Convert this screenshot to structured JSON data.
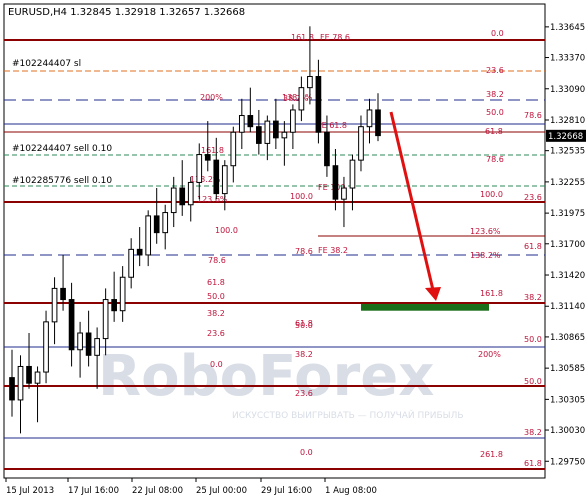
{
  "header": {
    "symbol_line": "EURUSD,H4  1.32845 1.32918 1.32657 1.32668"
  },
  "colors": {
    "up_candle": "#ffffff",
    "candle_edge": "#000000",
    "axis_text": "#000000",
    "fibo_level_text": "#c0143c",
    "line_blue": "#1f2d8c",
    "line_red": "#8b0000",
    "line_green_dash": "#2e8b57",
    "line_orange_dash": "#e07020",
    "arrow_red": "#e01010",
    "target_box": "#1a6e1a",
    "current_price_label_bg": "#000000",
    "watermark": "#d8dde6"
  },
  "watermark": {
    "brand": "RoboForex",
    "tagline": "ИСКУССТВО ВЫИГРЫВАТЬ — ПОЛУЧАЙ ПРИБЫЛЬ"
  },
  "chart_data": {
    "type": "candlestick",
    "title": "EURUSD,H4",
    "ohlc_header": {
      "open": 1.32845,
      "high": 1.32918,
      "low": 1.32657,
      "close": 1.32668
    },
    "current_price": 1.32668,
    "ylim": [
      1.296,
      1.3385
    ],
    "y_ticks": [
      "1.33645",
      "1.33370",
      "1.33090",
      "1.32810",
      "1.32535",
      "1.32255",
      "1.31975",
      "1.31700",
      "1.31420",
      "1.31140",
      "1.30865",
      "1.30585",
      "1.30305",
      "1.30030",
      "1.29750"
    ],
    "y_tick_values": [
      1.33645,
      1.3337,
      1.3309,
      1.3281,
      1.32535,
      1.32255,
      1.31975,
      1.317,
      1.3142,
      1.3114,
      1.30865,
      1.30585,
      1.30305,
      1.3003,
      1.2975
    ],
    "x_ticks": [
      "15 Jul 2013",
      "17 Jul 16:00",
      "22 Jul 08:00",
      "25 Jul 00:00",
      "29 Jul 16:00",
      "1 Aug 08:00"
    ],
    "candles": [
      [
        1.305,
        1.3075,
        1.3015,
        1.303
      ],
      [
        1.303,
        1.307,
        1.3,
        1.306
      ],
      [
        1.306,
        1.309,
        1.304,
        1.3045
      ],
      [
        1.3045,
        1.306,
        1.301,
        1.3055
      ],
      [
        1.3055,
        1.311,
        1.3045,
        1.31
      ],
      [
        1.31,
        1.314,
        1.308,
        1.313
      ],
      [
        1.313,
        1.316,
        1.311,
        1.312
      ],
      [
        1.312,
        1.3135,
        1.306,
        1.3075
      ],
      [
        1.3075,
        1.31,
        1.305,
        1.309
      ],
      [
        1.309,
        1.311,
        1.306,
        1.307
      ],
      [
        1.307,
        1.3095,
        1.304,
        1.3085
      ],
      [
        1.3085,
        1.313,
        1.307,
        1.312
      ],
      [
        1.312,
        1.3145,
        1.31,
        1.311
      ],
      [
        1.311,
        1.315,
        1.31,
        1.314
      ],
      [
        1.314,
        1.3175,
        1.313,
        1.3165
      ],
      [
        1.3165,
        1.3185,
        1.315,
        1.316
      ],
      [
        1.316,
        1.32,
        1.315,
        1.3195
      ],
      [
        1.3195,
        1.322,
        1.317,
        1.318
      ],
      [
        1.318,
        1.3205,
        1.3165,
        1.3198
      ],
      [
        1.3198,
        1.323,
        1.3185,
        1.322
      ],
      [
        1.322,
        1.3245,
        1.3195,
        1.3205
      ],
      [
        1.3205,
        1.323,
        1.319,
        1.3225
      ],
      [
        1.3225,
        1.326,
        1.321,
        1.325
      ],
      [
        1.325,
        1.328,
        1.3235,
        1.3245
      ],
      [
        1.3245,
        1.3265,
        1.321,
        1.3215
      ],
      [
        1.3215,
        1.3245,
        1.32,
        1.324
      ],
      [
        1.324,
        1.3275,
        1.3225,
        1.327
      ],
      [
        1.327,
        1.33,
        1.3255,
        1.3285
      ],
      [
        1.3285,
        1.331,
        1.327,
        1.3275
      ],
      [
        1.3275,
        1.329,
        1.325,
        1.326
      ],
      [
        1.326,
        1.3285,
        1.3245,
        1.328
      ],
      [
        1.328,
        1.33,
        1.3255,
        1.3265
      ],
      [
        1.3265,
        1.328,
        1.324,
        1.327
      ],
      [
        1.327,
        1.3295,
        1.3255,
        1.329
      ],
      [
        1.329,
        1.332,
        1.328,
        1.331
      ],
      [
        1.331,
        1.3365,
        1.3295,
        1.332
      ],
      [
        1.332,
        1.3335,
        1.326,
        1.327
      ],
      [
        1.327,
        1.3285,
        1.323,
        1.324
      ],
      [
        1.324,
        1.3255,
        1.32,
        1.321
      ],
      [
        1.321,
        1.323,
        1.3185,
        1.322
      ],
      [
        1.322,
        1.325,
        1.32,
        1.3245
      ],
      [
        1.3245,
        1.3285,
        1.3235,
        1.3275
      ],
      [
        1.3275,
        1.33,
        1.326,
        1.329
      ],
      [
        1.329,
        1.3305,
        1.3262,
        1.3267
      ]
    ],
    "fibo_labels_left": [
      "161.8",
      "200%",
      "138.2%",
      "161.8",
      "138.2%",
      "123.6%",
      "100.0",
      "78.6",
      "61.8",
      "50.0",
      "38.2",
      "23.6",
      "0.0"
    ],
    "fibo_labels_mid": [
      "FE 78.6",
      "38.2%",
      "FE 61.8",
      "FE 100",
      "100.0",
      "78.6",
      "FE 38.2",
      "61.8",
      "50.0",
      "38.2",
      "23.6",
      "0.0"
    ],
    "fibo_labels_right": [
      "0.0",
      "23.6",
      "38.2",
      "50.0",
      "78.6",
      "61.8",
      "78.6",
      "100.0",
      "23.6",
      "123.6%",
      "61.8",
      "138.2%",
      "161.8",
      "38.2",
      "50.0",
      "200%",
      "50.0",
      "38.2",
      "261.8",
      "61.8"
    ],
    "orders": [
      "#102244407 sl",
      "#102244407 sell 0.10",
      "#102285776 sell 0.10"
    ],
    "target_zone": {
      "from": 1.3116,
      "to": 1.311
    }
  }
}
